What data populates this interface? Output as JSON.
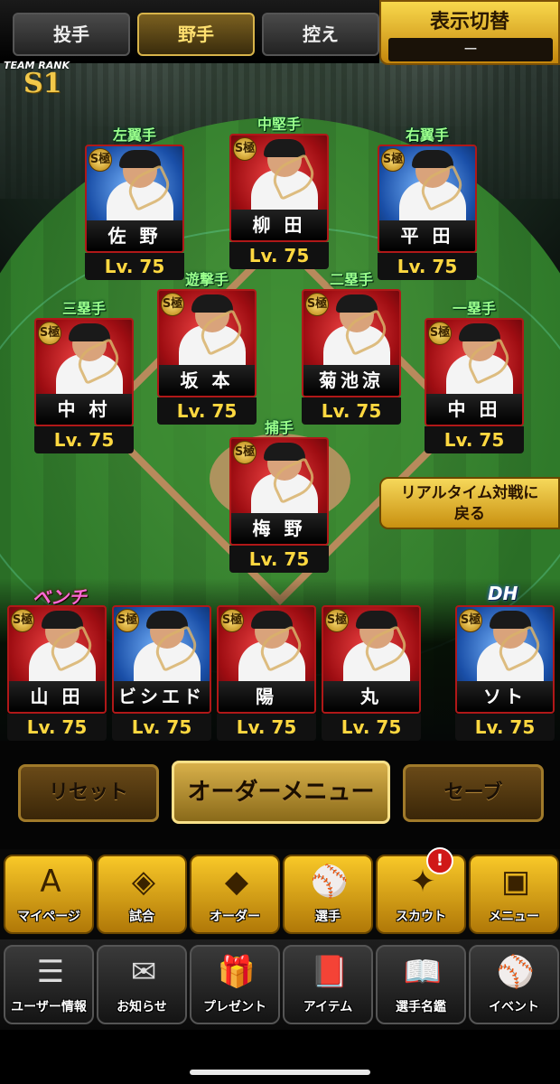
{
  "tabs": [
    "投手",
    "野手",
    "控え"
  ],
  "active_tab": "野手",
  "display_switch": {
    "title": "表示切替",
    "value": "ー"
  },
  "team_rank": {
    "label": "TEAM RANK",
    "value": "S1"
  },
  "gem_label": "S極",
  "fielders": [
    {
      "position": "左翼手",
      "name": "佐 野",
      "level": "Lv. 75",
      "theme": "blue"
    },
    {
      "position": "中堅手",
      "name": "柳 田",
      "level": "Lv. 75",
      "theme": "red"
    },
    {
      "position": "右翼手",
      "name": "平 田",
      "level": "Lv. 75",
      "theme": "blue"
    },
    {
      "position": "遊撃手",
      "name": "坂 本",
      "level": "Lv. 75",
      "theme": "red"
    },
    {
      "position": "二塁手",
      "name": "菊池涼",
      "level": "Lv. 75",
      "theme": "red"
    },
    {
      "position": "三塁手",
      "name": "中 村",
      "level": "Lv. 75",
      "theme": "red"
    },
    {
      "position": "一塁手",
      "name": "中 田",
      "level": "Lv. 75",
      "theme": "red"
    },
    {
      "position": "捕手",
      "name": "梅 野",
      "level": "Lv. 75",
      "theme": "red"
    }
  ],
  "return_button": {
    "line1": "リアルタイム対戦に",
    "line2": "戻る"
  },
  "bench_label": "ベンチ",
  "dh_label": "DH",
  "bench": [
    {
      "name": "山 田",
      "level": "Lv. 75",
      "theme": "red"
    },
    {
      "name": "ビシエド",
      "level": "Lv. 75",
      "theme": "blue"
    },
    {
      "name": "陽",
      "level": "Lv. 75",
      "theme": "red"
    },
    {
      "name": "丸",
      "level": "Lv. 75",
      "theme": "red"
    },
    {
      "name": "ソト",
      "level": "Lv. 75",
      "theme": "blue"
    }
  ],
  "order_buttons": {
    "reset": "リセット",
    "menu": "オーダーメニュー",
    "save": "セーブ"
  },
  "nav_main": [
    {
      "label": "マイページ",
      "icon": "A"
    },
    {
      "label": "試合",
      "icon": "◈"
    },
    {
      "label": "オーダー",
      "icon": "◆"
    },
    {
      "label": "選手",
      "icon": "⚾"
    },
    {
      "label": "スカウト",
      "icon": "✦"
    },
    {
      "label": "メニュー",
      "icon": "▣"
    }
  ],
  "scout_badge": "!",
  "nav_sub": [
    {
      "label": "ユーザー情報",
      "icon": "☰"
    },
    {
      "label": "お知らせ",
      "icon": "✉"
    },
    {
      "label": "プレゼント",
      "icon": "🎁"
    },
    {
      "label": "アイテム",
      "icon": "📕"
    },
    {
      "label": "選手名鑑",
      "icon": "📖"
    },
    {
      "label": "イベント",
      "icon": "⚾"
    }
  ]
}
